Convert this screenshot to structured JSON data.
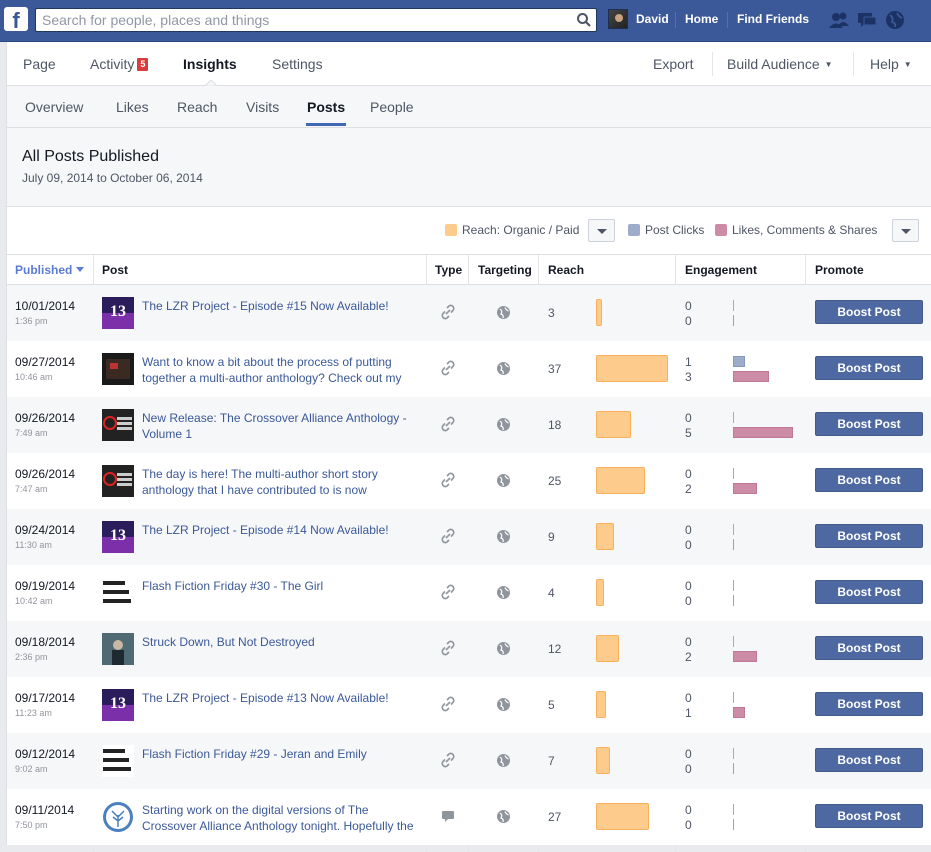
{
  "topbar": {
    "logo": "f",
    "search_placeholder": "Search for people, places and things",
    "user_name": "David",
    "home": "Home",
    "find_friends": "Find Friends",
    "icons": [
      "friend-requests-icon",
      "messages-icon",
      "notifications-globe-icon"
    ]
  },
  "page_nav": {
    "items": [
      "Page",
      "Activity",
      "Insights",
      "Settings"
    ],
    "activity_badge": "5",
    "active": "Insights",
    "right": [
      "Export",
      "Build Audience",
      "Help"
    ]
  },
  "sub_nav": {
    "items": [
      "Overview",
      "Likes",
      "Reach",
      "Visits",
      "Posts",
      "People"
    ],
    "active": "Posts"
  },
  "header": {
    "title": "All Posts Published",
    "date_from": "July 09, 2014",
    "date_to_word": "to",
    "date_to": "October 06, 2014"
  },
  "legend": {
    "reach": "Reach: Organic / Paid",
    "clicks": "Post Clicks",
    "likes": "Likes, Comments & Shares",
    "colors": {
      "reach": "#fdcc8c",
      "clicks": "#9eaccc",
      "likes": "#cc8ca5"
    }
  },
  "columns": [
    "Published",
    "Post",
    "Type",
    "Targeting",
    "Reach",
    "Engagement",
    "Promote"
  ],
  "rows": [
    {
      "date": "10/01/2014",
      "time": "1:36 pm",
      "post": "The LZR Project - Episode #15 Now Available!",
      "thumb": "lzr",
      "type": "link-icon",
      "reach": "3",
      "reach_value": 3,
      "clicks": "0",
      "likes": "0",
      "promote": "Boost Post"
    },
    {
      "date": "09/27/2014",
      "time": "10:46 am",
      "post": "Want to know a bit about the process of putting together a multi-author anthology? Check out my",
      "thumb": "dark",
      "type": "link-icon",
      "reach": "37",
      "reach_value": 37,
      "clicks": "1",
      "likes": "3",
      "promote": "Boost Post"
    },
    {
      "date": "09/26/2014",
      "time": "7:49 am",
      "post": "New Release: The Crossover Alliance Anthology - Volume 1",
      "thumb": "crossover",
      "type": "link-icon",
      "reach": "18",
      "reach_value": 18,
      "clicks": "0",
      "likes": "5",
      "promote": "Boost Post"
    },
    {
      "date": "09/26/2014",
      "time": "7:47 am",
      "post": "The day is here! The multi-author short story anthology that I have contributed to is now",
      "thumb": "crossover",
      "type": "link-icon",
      "reach": "25",
      "reach_value": 25,
      "clicks": "0",
      "likes": "2",
      "promote": "Boost Post"
    },
    {
      "date": "09/24/2014",
      "time": "11:30 am",
      "post": "The LZR Project - Episode #14 Now Available!",
      "thumb": "lzr",
      "type": "link-icon",
      "reach": "9",
      "reach_value": 9,
      "clicks": "0",
      "likes": "0",
      "promote": "Boost Post"
    },
    {
      "date": "09/19/2014",
      "time": "10:42 am",
      "post": "Flash Fiction Friday #30 - The Girl",
      "thumb": "fff",
      "type": "link-icon",
      "reach": "4",
      "reach_value": 4,
      "clicks": "0",
      "likes": "0",
      "promote": "Boost Post"
    },
    {
      "date": "09/18/2014",
      "time": "2:36 pm",
      "post": "Struck Down, But Not Destroyed",
      "thumb": "struck",
      "type": "link-icon",
      "reach": "12",
      "reach_value": 12,
      "clicks": "0",
      "likes": "2",
      "promote": "Boost Post"
    },
    {
      "date": "09/17/2014",
      "time": "11:23 am",
      "post": "The LZR Project - Episode #13 Now Available!",
      "thumb": "lzr",
      "type": "link-icon",
      "reach": "5",
      "reach_value": 5,
      "clicks": "0",
      "likes": "1",
      "promote": "Boost Post"
    },
    {
      "date": "09/12/2014",
      "time": "9:02 am",
      "post": "Flash Fiction Friday #29 - Jeran and Emily",
      "thumb": "fff",
      "type": "link-icon",
      "reach": "7",
      "reach_value": 7,
      "clicks": "0",
      "likes": "0",
      "promote": "Boost Post"
    },
    {
      "date": "09/11/2014",
      "time": "7:50 pm",
      "post": "Starting work on the digital versions of The Crossover Alliance Anthology tonight. Hopefully the",
      "thumb": "tree",
      "type": "status-icon",
      "reach": "27",
      "reach_value": 27,
      "clicks": "0",
      "likes": "0",
      "promote": "Boost Post"
    }
  ]
}
